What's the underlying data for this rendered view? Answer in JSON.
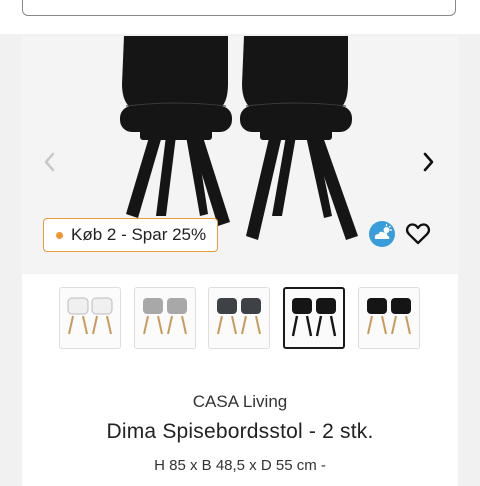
{
  "header": {
    "search_placeholder": ""
  },
  "gallery": {
    "promo_badge": "Køb 2 - Spar 25%",
    "prev_icon": "chevron-left-icon",
    "next_icon": "chevron-right-icon",
    "weather_icon": "cloud-sun-icon",
    "favorite_icon": "heart-outline-icon",
    "colors": {
      "promo_border": "#e89a3c",
      "promo_dot": "#f0962f",
      "weather_bg": "#3a9ddb",
      "chair": "#151515"
    }
  },
  "thumbnails": [
    {
      "variant": "white",
      "selected": false
    },
    {
      "variant": "light-grey",
      "selected": false
    },
    {
      "variant": "dark-grey",
      "selected": false
    },
    {
      "variant": "black-black-legs",
      "selected": true
    },
    {
      "variant": "black",
      "selected": false
    }
  ],
  "product": {
    "brand": "CASA Living",
    "title": "Dima Spisebordsstol - 2 stk.",
    "dimensions": "H 85 x B 48,5 x D 55 cm -"
  }
}
